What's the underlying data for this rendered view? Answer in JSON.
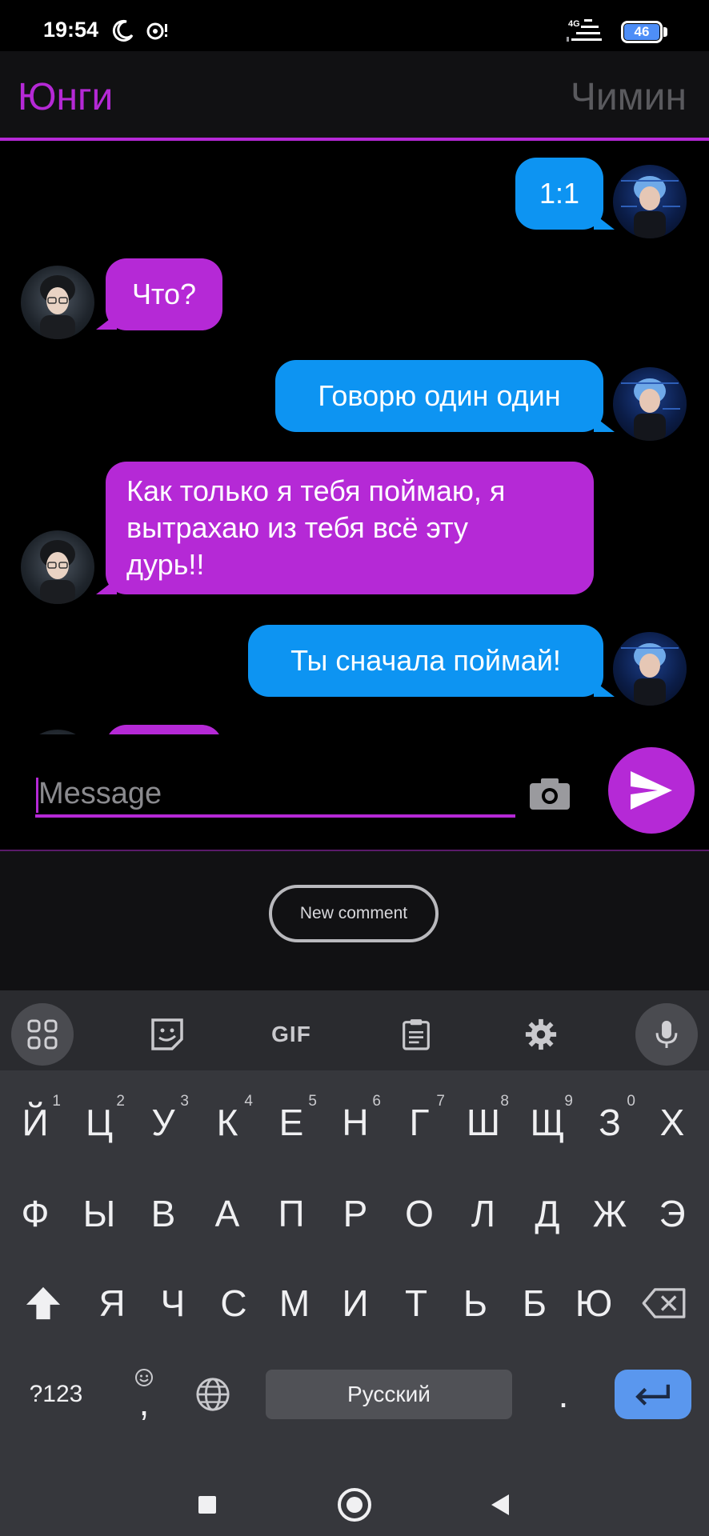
{
  "status_bar": {
    "time": "19:54",
    "network": "4G",
    "battery": "46"
  },
  "header": {
    "left_name": "Юнги",
    "right_name": "Чимин"
  },
  "messages": [
    {
      "side": "me",
      "text": "1:1"
    },
    {
      "side": "them",
      "text": "Что?"
    },
    {
      "side": "me",
      "text": "Говорю один один"
    },
    {
      "side": "them",
      "lines": [
        "Как только я тебя поймаю, я",
        "вытрахаю из тебя всё эту",
        "дурь!!"
      ]
    },
    {
      "side": "me",
      "text": "Ты сначала поймай!"
    }
  ],
  "input": {
    "placeholder": "Message"
  },
  "comment": {
    "button_label": "New comment"
  },
  "keyboard": {
    "toolbar": {
      "gif_label": "GIF"
    },
    "row1": [
      {
        "key": "Й",
        "hint": "1"
      },
      {
        "key": "Ц",
        "hint": "2"
      },
      {
        "key": "У",
        "hint": "3"
      },
      {
        "key": "К",
        "hint": "4"
      },
      {
        "key": "Е",
        "hint": "5"
      },
      {
        "key": "Н",
        "hint": "6"
      },
      {
        "key": "Г",
        "hint": "7"
      },
      {
        "key": "Ш",
        "hint": "8"
      },
      {
        "key": "Щ",
        "hint": "9"
      },
      {
        "key": "З",
        "hint": "0"
      },
      {
        "key": "Х",
        "hint": ""
      }
    ],
    "row2": [
      "Ф",
      "Ы",
      "В",
      "А",
      "П",
      "Р",
      "О",
      "Л",
      "Д",
      "Ж",
      "Э"
    ],
    "row3": [
      "Я",
      "Ч",
      "С",
      "М",
      "И",
      "Т",
      "Ь",
      "Б",
      "Ю"
    ],
    "numbers_label": "?123",
    "comma_label": ",",
    "space_label": "Русский",
    "period_label": "."
  },
  "colors": {
    "accent": "#b529d6",
    "outgoing": "#0d94f2",
    "enter": "#5a97ee"
  }
}
